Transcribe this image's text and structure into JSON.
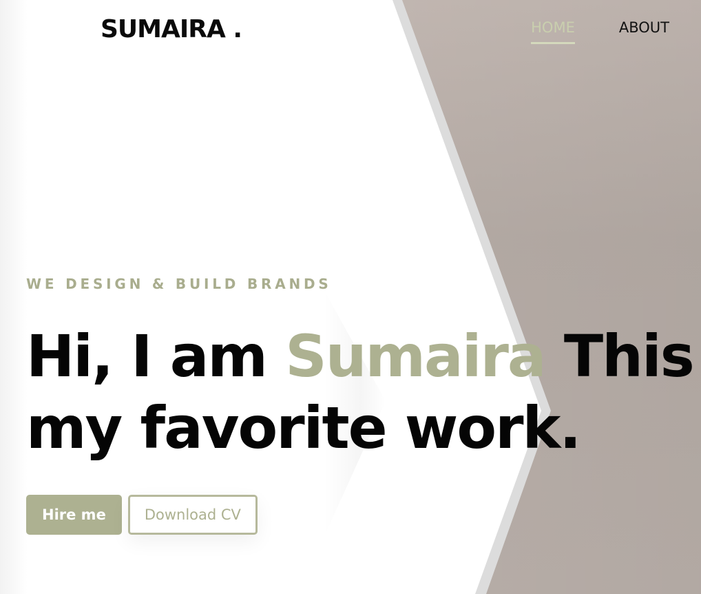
{
  "header": {
    "logo": "SUMAIRA .",
    "nav": [
      {
        "label": "HOME",
        "active": true
      },
      {
        "label": "ABOUT",
        "active": false
      }
    ]
  },
  "hero": {
    "tagline": "WE DESIGN & BUILD BRANDS",
    "headline_pre": "Hi, I am ",
    "headline_name": "Sumaira",
    "headline_post": " This is my favorite work.",
    "buttons": {
      "hire_label": "Hire me",
      "download_label": "Download CV"
    },
    "photo_description_icon": "portrait-photo"
  },
  "colors": {
    "accent": "#adb191",
    "nav_active": "#c9cfae",
    "text": "#050505",
    "scarf": "#f3242f"
  }
}
